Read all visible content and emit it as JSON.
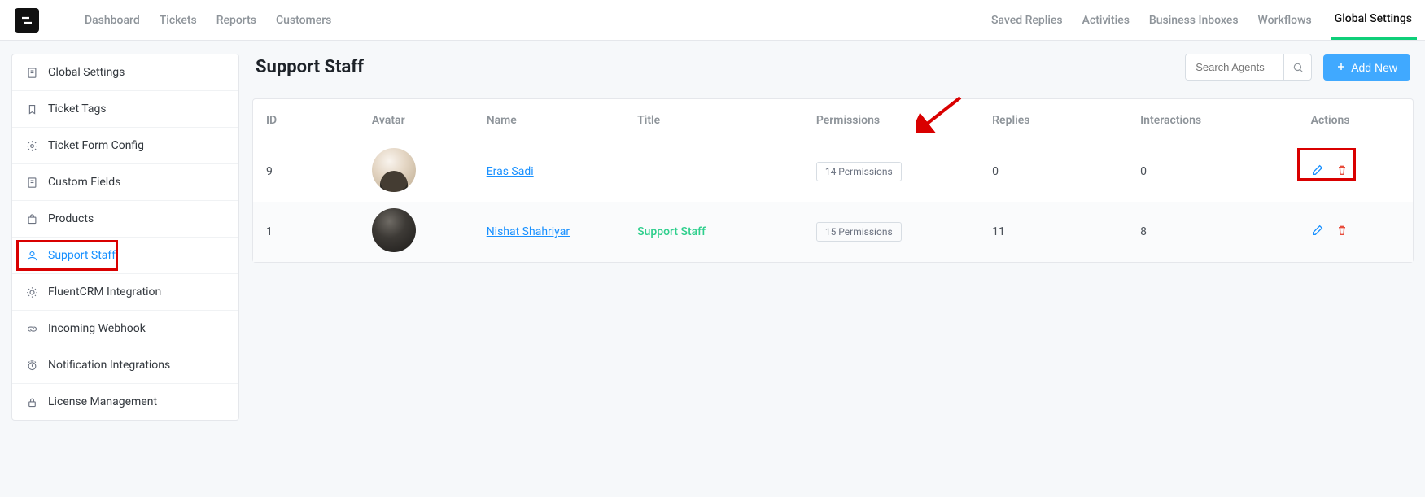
{
  "top_nav_left": [
    "Dashboard",
    "Tickets",
    "Reports",
    "Customers"
  ],
  "top_nav_right": [
    "Saved Replies",
    "Activities",
    "Business Inboxes",
    "Workflows",
    "Global Settings"
  ],
  "top_nav_right_active": 4,
  "sidebar": {
    "items": [
      {
        "label": "Global Settings",
        "icon": "doc"
      },
      {
        "label": "Ticket Tags",
        "icon": "bookmark"
      },
      {
        "label": "Ticket Form Config",
        "icon": "gear"
      },
      {
        "label": "Custom Fields",
        "icon": "doc"
      },
      {
        "label": "Products",
        "icon": "bag"
      },
      {
        "label": "Support Staff",
        "icon": "user"
      },
      {
        "label": "FluentCRM Integration",
        "icon": "sun"
      },
      {
        "label": "Incoming Webhook",
        "icon": "link"
      },
      {
        "label": "Notification Integrations",
        "icon": "clock"
      },
      {
        "label": "License Management",
        "icon": "lock"
      }
    ],
    "active": 5
  },
  "page": {
    "title": "Support Staff",
    "search_placeholder": "Search Agents",
    "add_button": "Add New"
  },
  "table": {
    "columns": [
      "ID",
      "Avatar",
      "Name",
      "Title",
      "Permissions",
      "Replies",
      "Interactions",
      "Actions"
    ],
    "rows": [
      {
        "id": "9",
        "name": "Eras Sadi",
        "title": "",
        "permissions": "14 Permissions",
        "replies": "0",
        "interactions": "0",
        "avatar": "lite",
        "highlight": true
      },
      {
        "id": "1",
        "name": "Nishat Shahriyar",
        "title": "Support Staff",
        "permissions": "15 Permissions",
        "replies": "11",
        "interactions": "8",
        "avatar": "dark",
        "highlight": false
      }
    ]
  }
}
